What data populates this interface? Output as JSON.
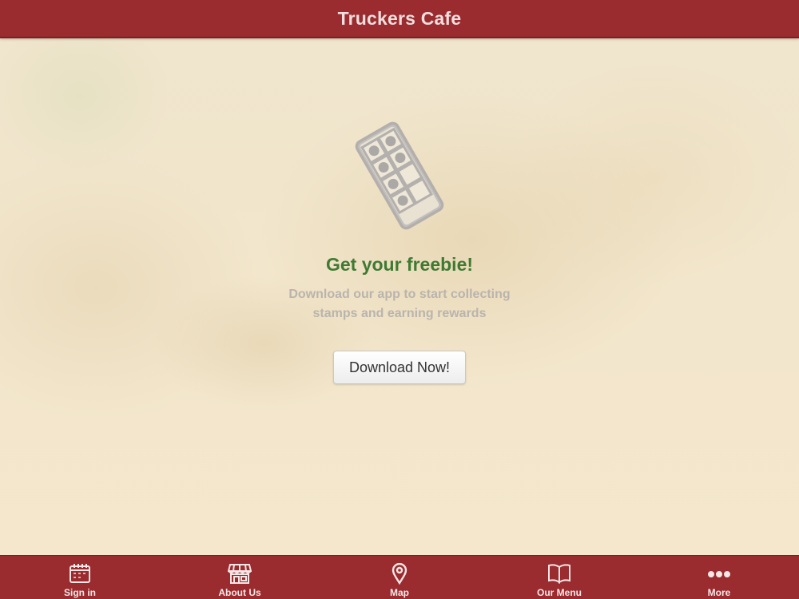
{
  "header": {
    "title": "Truckers Cafe"
  },
  "promo": {
    "icon": "stamp-card-icon",
    "headline": "Get your freebie!",
    "description": "Download our app to start collecting stamps and earning rewards",
    "button_label": "Download Now!"
  },
  "tabbar": {
    "items": [
      {
        "label": "Sign in",
        "icon": "calendar-icon"
      },
      {
        "label": "About Us",
        "icon": "storefront-icon"
      },
      {
        "label": "Map",
        "icon": "map-pin-icon"
      },
      {
        "label": "Our Menu",
        "icon": "open-book-icon"
      },
      {
        "label": "More",
        "icon": "more-dots-icon"
      }
    ]
  },
  "colors": {
    "brand_red": "#9a2b2e",
    "headline_green": "#3f7a32",
    "background": "#f1e6cd"
  }
}
